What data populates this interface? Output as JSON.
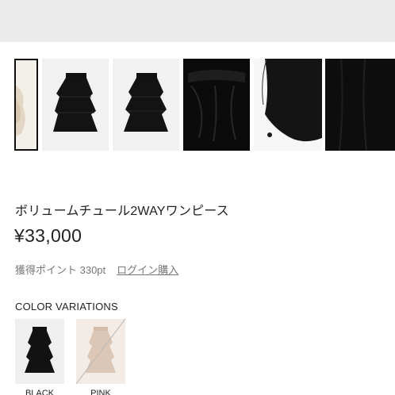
{
  "product": {
    "name": "ボリュームチュール2WAYワンピース",
    "price": "¥33,000",
    "points_label": "獲得ポイント 330pt",
    "login_purchase_link": "ログイン購入"
  },
  "gallery": {
    "thumbnails": [
      {
        "color": "beige-skirt-icon",
        "selected": true
      },
      {
        "color": "black-skirt-icon",
        "selected": false
      },
      {
        "color": "black-skirt-icon",
        "selected": false
      },
      {
        "color": "black-waistband-detail-icon",
        "selected": false
      },
      {
        "color": "black-tulle-detail-icon",
        "selected": false
      },
      {
        "color": "black-fabric-detail-icon",
        "selected": false
      }
    ]
  },
  "variations": {
    "title": "COLOR VARIATIONS",
    "items": [
      {
        "label": "BLACK",
        "color": "#111111"
      },
      {
        "label": "PINK",
        "color": "#d9c2b3"
      }
    ]
  },
  "colors": {
    "top_bar": "#ebebeb",
    "text": "#222222",
    "muted_text": "#777777"
  }
}
